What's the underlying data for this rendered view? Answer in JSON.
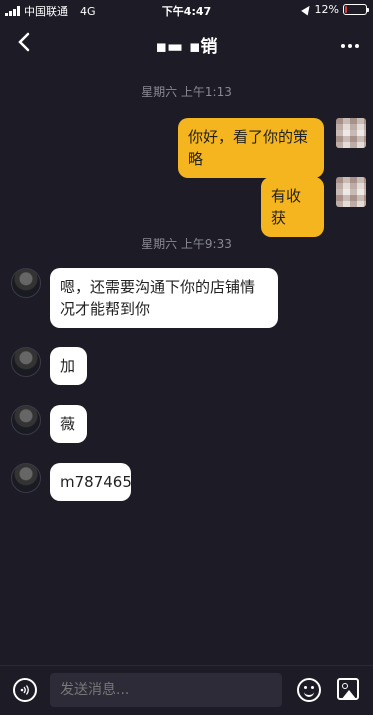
{
  "status_bar": {
    "carrier": "中国联通",
    "network": "4G",
    "time": "下午4:47",
    "battery": "12%"
  },
  "header": {
    "title": "▪▬ ▪销",
    "back_icon": "chevron-left-icon",
    "more_icon": "more-horizontal-icon"
  },
  "messages": [
    {
      "type": "timestamp",
      "text": "星期六 上午1:13"
    },
    {
      "type": "out",
      "text": "你好，看了你的策略"
    },
    {
      "type": "out",
      "text": "有收获"
    },
    {
      "type": "timestamp",
      "text": "星期六 上午9:33"
    },
    {
      "type": "in",
      "text": "嗯，还需要沟通下你的店铺情况才能帮到你"
    },
    {
      "type": "in",
      "text": "加"
    },
    {
      "type": "in",
      "text": "薇"
    },
    {
      "type": "in",
      "text": "m787465"
    }
  ],
  "input": {
    "placeholder": "发送消息..."
  },
  "colors": {
    "background": "#1c1b26",
    "outgoing_bubble": "#f5b51e",
    "incoming_bubble": "#ffffff",
    "battery_low": "#e23b3b"
  }
}
